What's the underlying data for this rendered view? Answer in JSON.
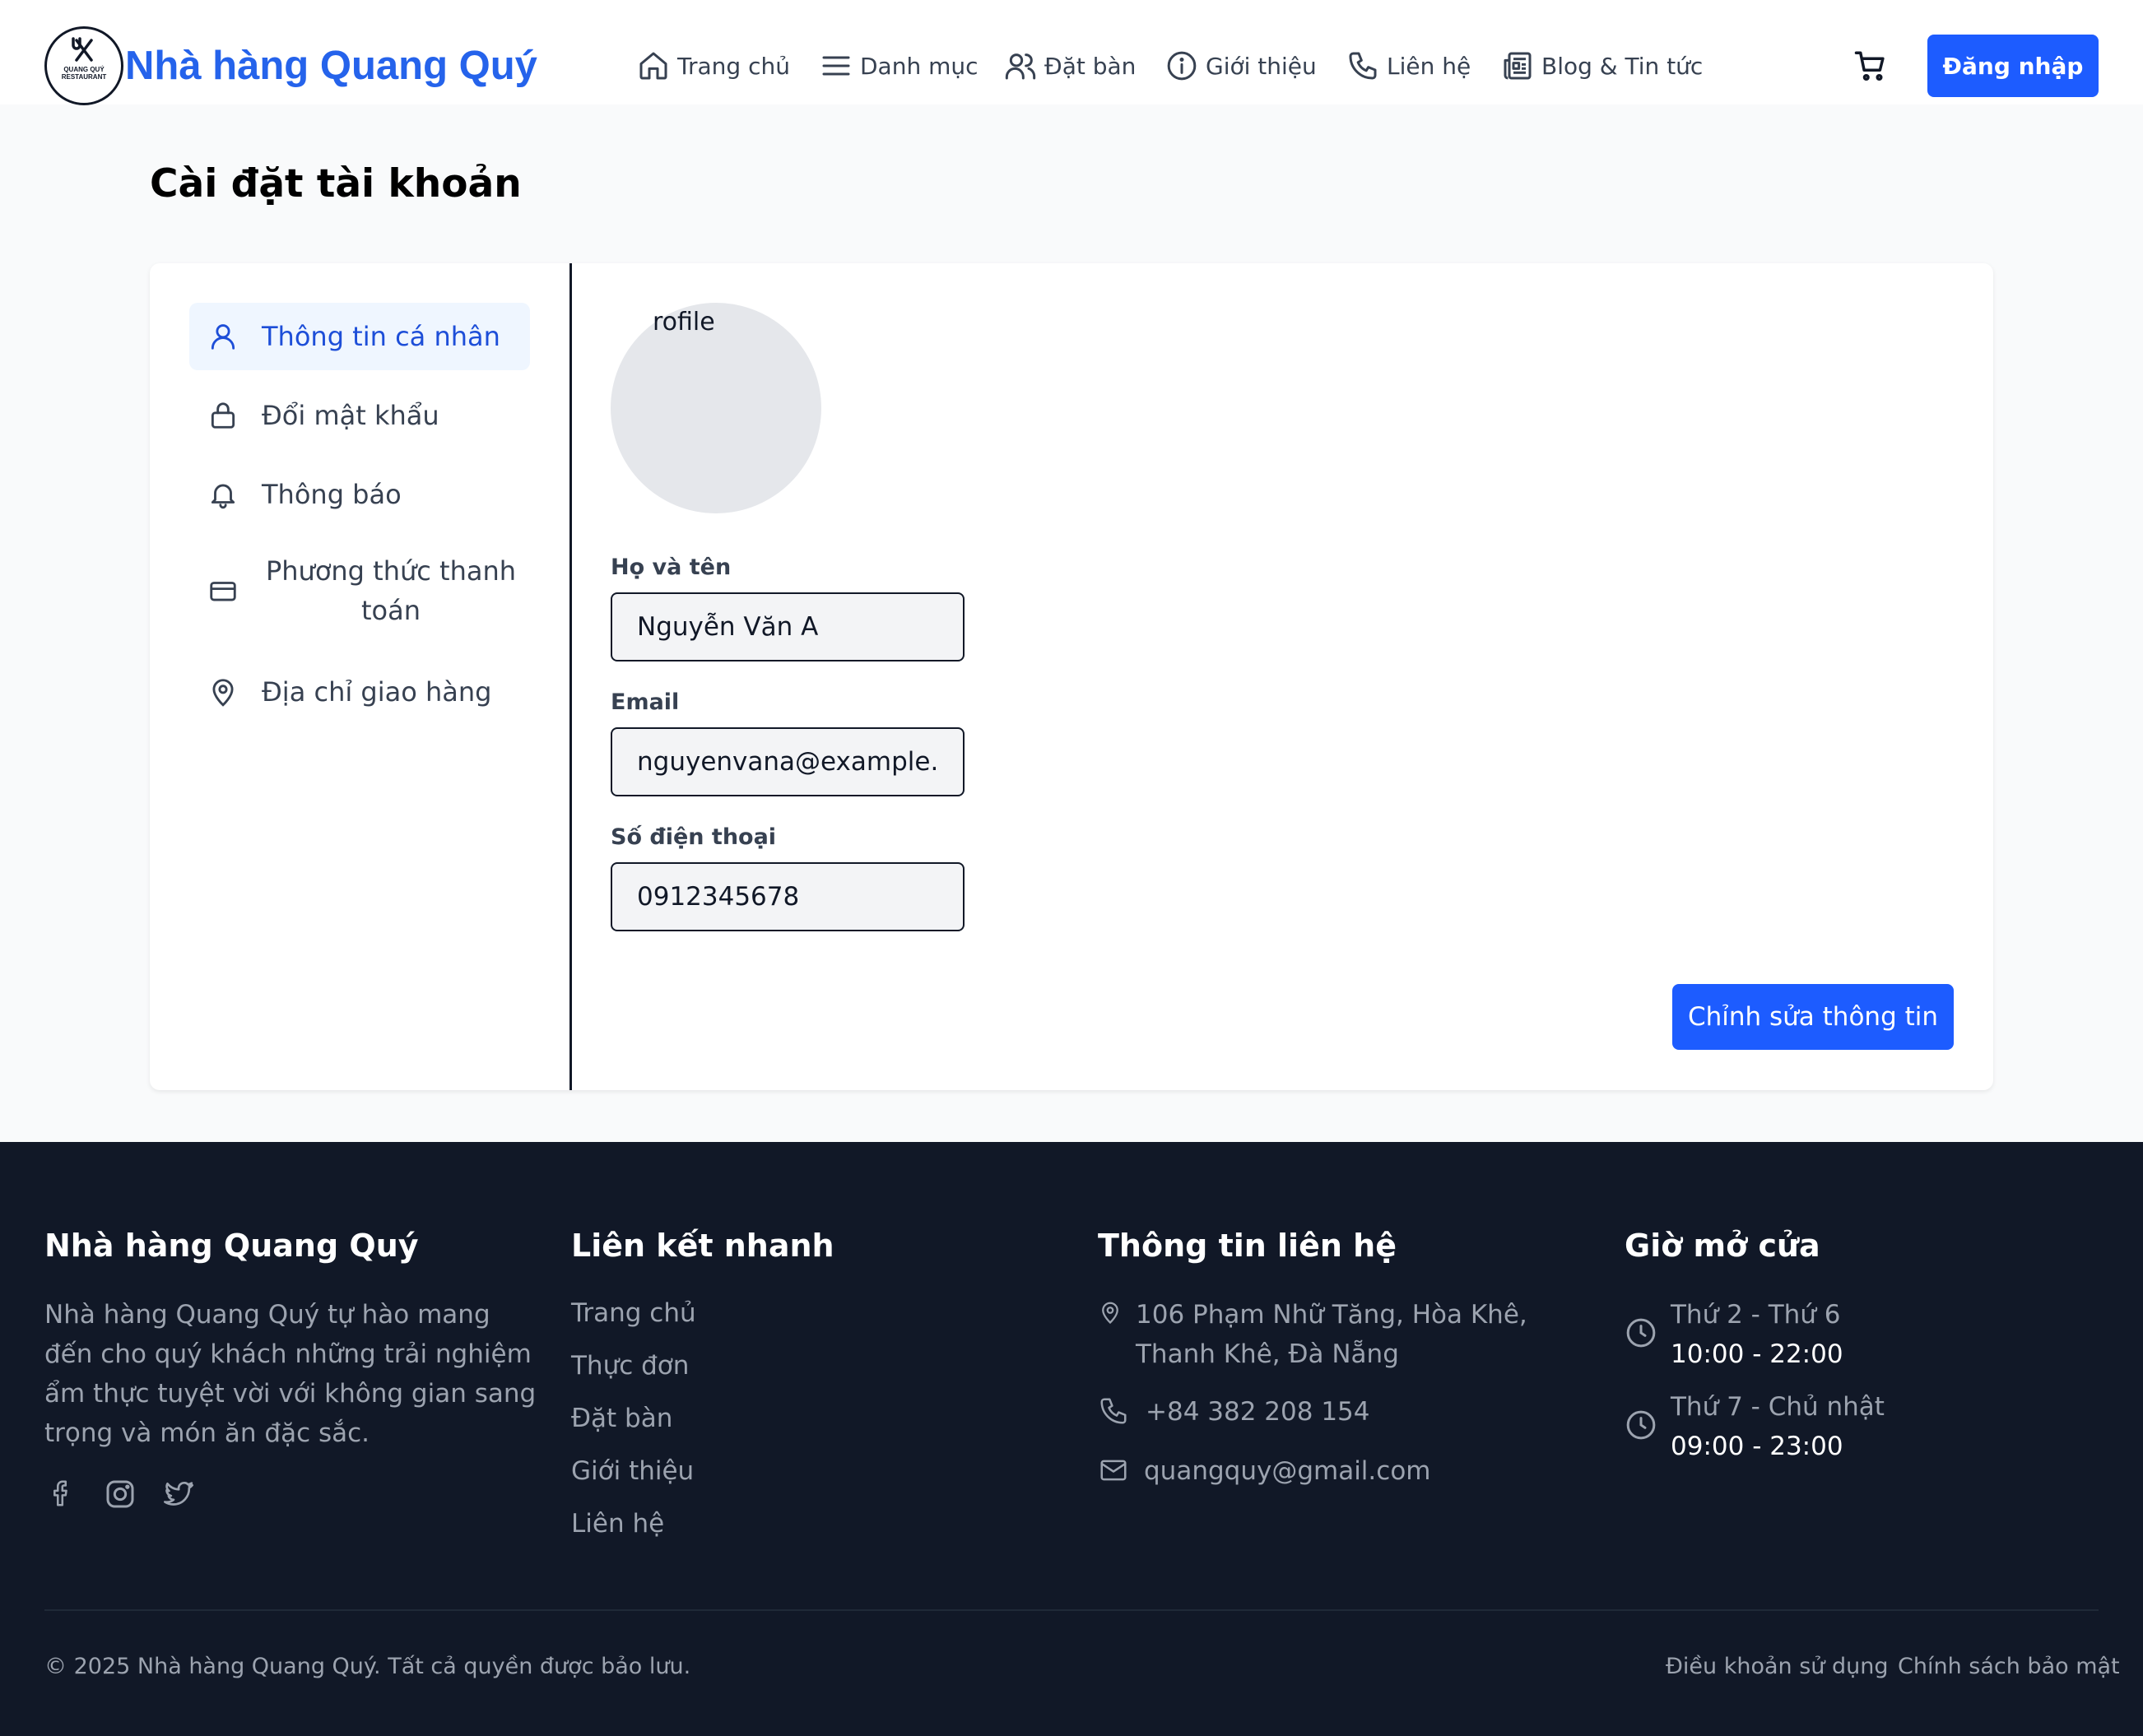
{
  "header": {
    "logo_text_line1": "QUANG QUÝ",
    "logo_text_line2": "RESTAURANT",
    "brand": "Nhà hàng Quang Quý",
    "nav": [
      {
        "label": "Trang chủ",
        "icon": "home-icon"
      },
      {
        "label": "Danh mục",
        "icon": "menu-lines-icon"
      },
      {
        "label": "Đặt bàn",
        "icon": "users-icon"
      },
      {
        "label": "Giới thiệu",
        "icon": "info-icon"
      },
      {
        "label": "Liên hệ",
        "icon": "phone-icon"
      },
      {
        "label": "Blog & Tin tức",
        "icon": "newspaper-icon"
      }
    ],
    "cart_icon": "cart-icon",
    "login_label": "Đăng nhập"
  },
  "page": {
    "title": "Cài đặt tài khoản"
  },
  "sidebar": {
    "items": [
      {
        "label": "Thông tin cá nhân",
        "icon": "user-icon",
        "active": true
      },
      {
        "label": "Đổi mật khẩu",
        "icon": "lock-icon"
      },
      {
        "label": "Thông báo",
        "icon": "bell-icon"
      },
      {
        "label": "Phương thức thanh toán",
        "icon": "credit-card-icon"
      },
      {
        "label": "Địa chỉ giao hàng",
        "icon": "map-pin-icon"
      }
    ]
  },
  "profile": {
    "avatar_alt": "rofile",
    "fields": [
      {
        "label": "Họ và tên",
        "value": "Nguyễn Văn A"
      },
      {
        "label": "Email",
        "value": "nguyenvana@example.co"
      },
      {
        "label": "Số điện thoại",
        "value": "0912345678"
      }
    ],
    "edit_label": "Chỉnh sửa thông tin"
  },
  "footer": {
    "about": {
      "title": "Nhà hàng Quang Quý",
      "description": "Nhà hàng Quang Quý tự hào mang đến cho quý khách những trải nghiệm ẩm thực tuyệt vời với không gian sang trọng và món ăn đặc sắc.",
      "social_icons": [
        "facebook-icon",
        "instagram-icon",
        "twitter-icon"
      ]
    },
    "links": {
      "title": "Liên kết nhanh",
      "items": [
        "Trang chủ",
        "Thực đơn",
        "Đặt bàn",
        "Giới thiệu",
        "Liên hệ"
      ]
    },
    "contact": {
      "title": "Thông tin liên hệ",
      "address": "106 Phạm Nhữ Tăng, Hòa Khê, Thanh Khê, Đà Nẵng",
      "phone": "+84 382 208 154",
      "email": "quangquy@gmail.com"
    },
    "hours": {
      "title": "Giờ mở cửa",
      "rows": [
        {
          "days": "Thứ 2 - Thứ 6",
          "time": "10:00 - 22:00"
        },
        {
          "days": "Thứ 7 - Chủ nhật",
          "time": "09:00 - 23:00"
        }
      ]
    },
    "copyright": "© 2025 Nhà hàng Quang Quý. Tất cả quyền được bảo lưu.",
    "terms": "Điều khoản sử dụng",
    "privacy": "Chính sách bảo mật"
  },
  "colors": {
    "brand": "#2563eb",
    "button": "#1d5cff",
    "footer_bg": "#111827"
  }
}
